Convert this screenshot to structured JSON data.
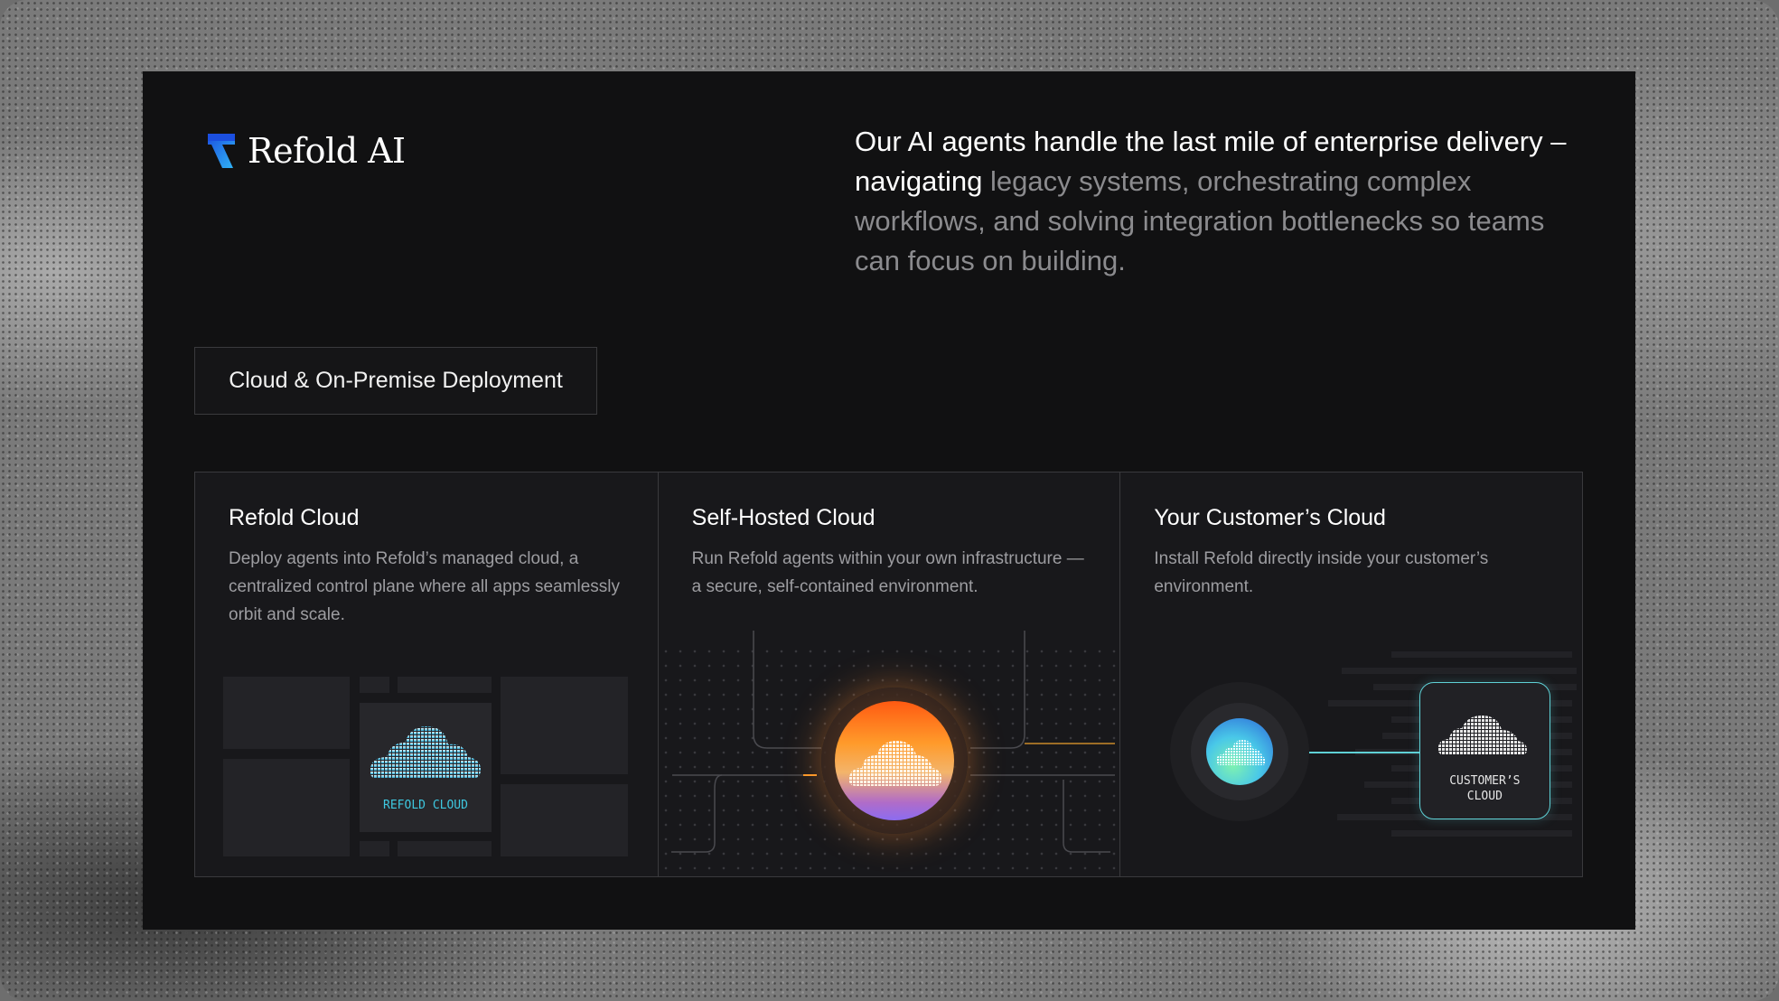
{
  "brand": {
    "name": "Refold AI",
    "accent": "#1e6ff0"
  },
  "tagline": {
    "highlight": "Our AI agents handle the last mile of enterprise delivery – navigating",
    "rest": " legacy systems, orchestrating complex workflows, and solving integration bottlenecks so teams can focus on building."
  },
  "section_label": "Cloud & On-Premise Deployment",
  "cards": [
    {
      "title": "Refold Cloud",
      "description": "Deploy agents into Refold’s managed cloud, a centralized control plane where all apps seamlessly orbit and scale.",
      "visual_label": "REFOLD CLOUD",
      "accent": "#3ec8e0"
    },
    {
      "title": "Self-Hosted Cloud",
      "description": "Run Refold agents within your own infrastructure — a secure, self-contained environment.",
      "accent": "#ff8a2a"
    },
    {
      "title": "Your Customer’s Cloud",
      "description": "Install Refold directly inside your customer’s environment.",
      "visual_label_line1": "CUSTOMER’S",
      "visual_label_line2": "CLOUD",
      "accent": "#5fd1d6"
    }
  ],
  "icons": [
    "refold-logo-icon",
    "cloud-icon"
  ]
}
